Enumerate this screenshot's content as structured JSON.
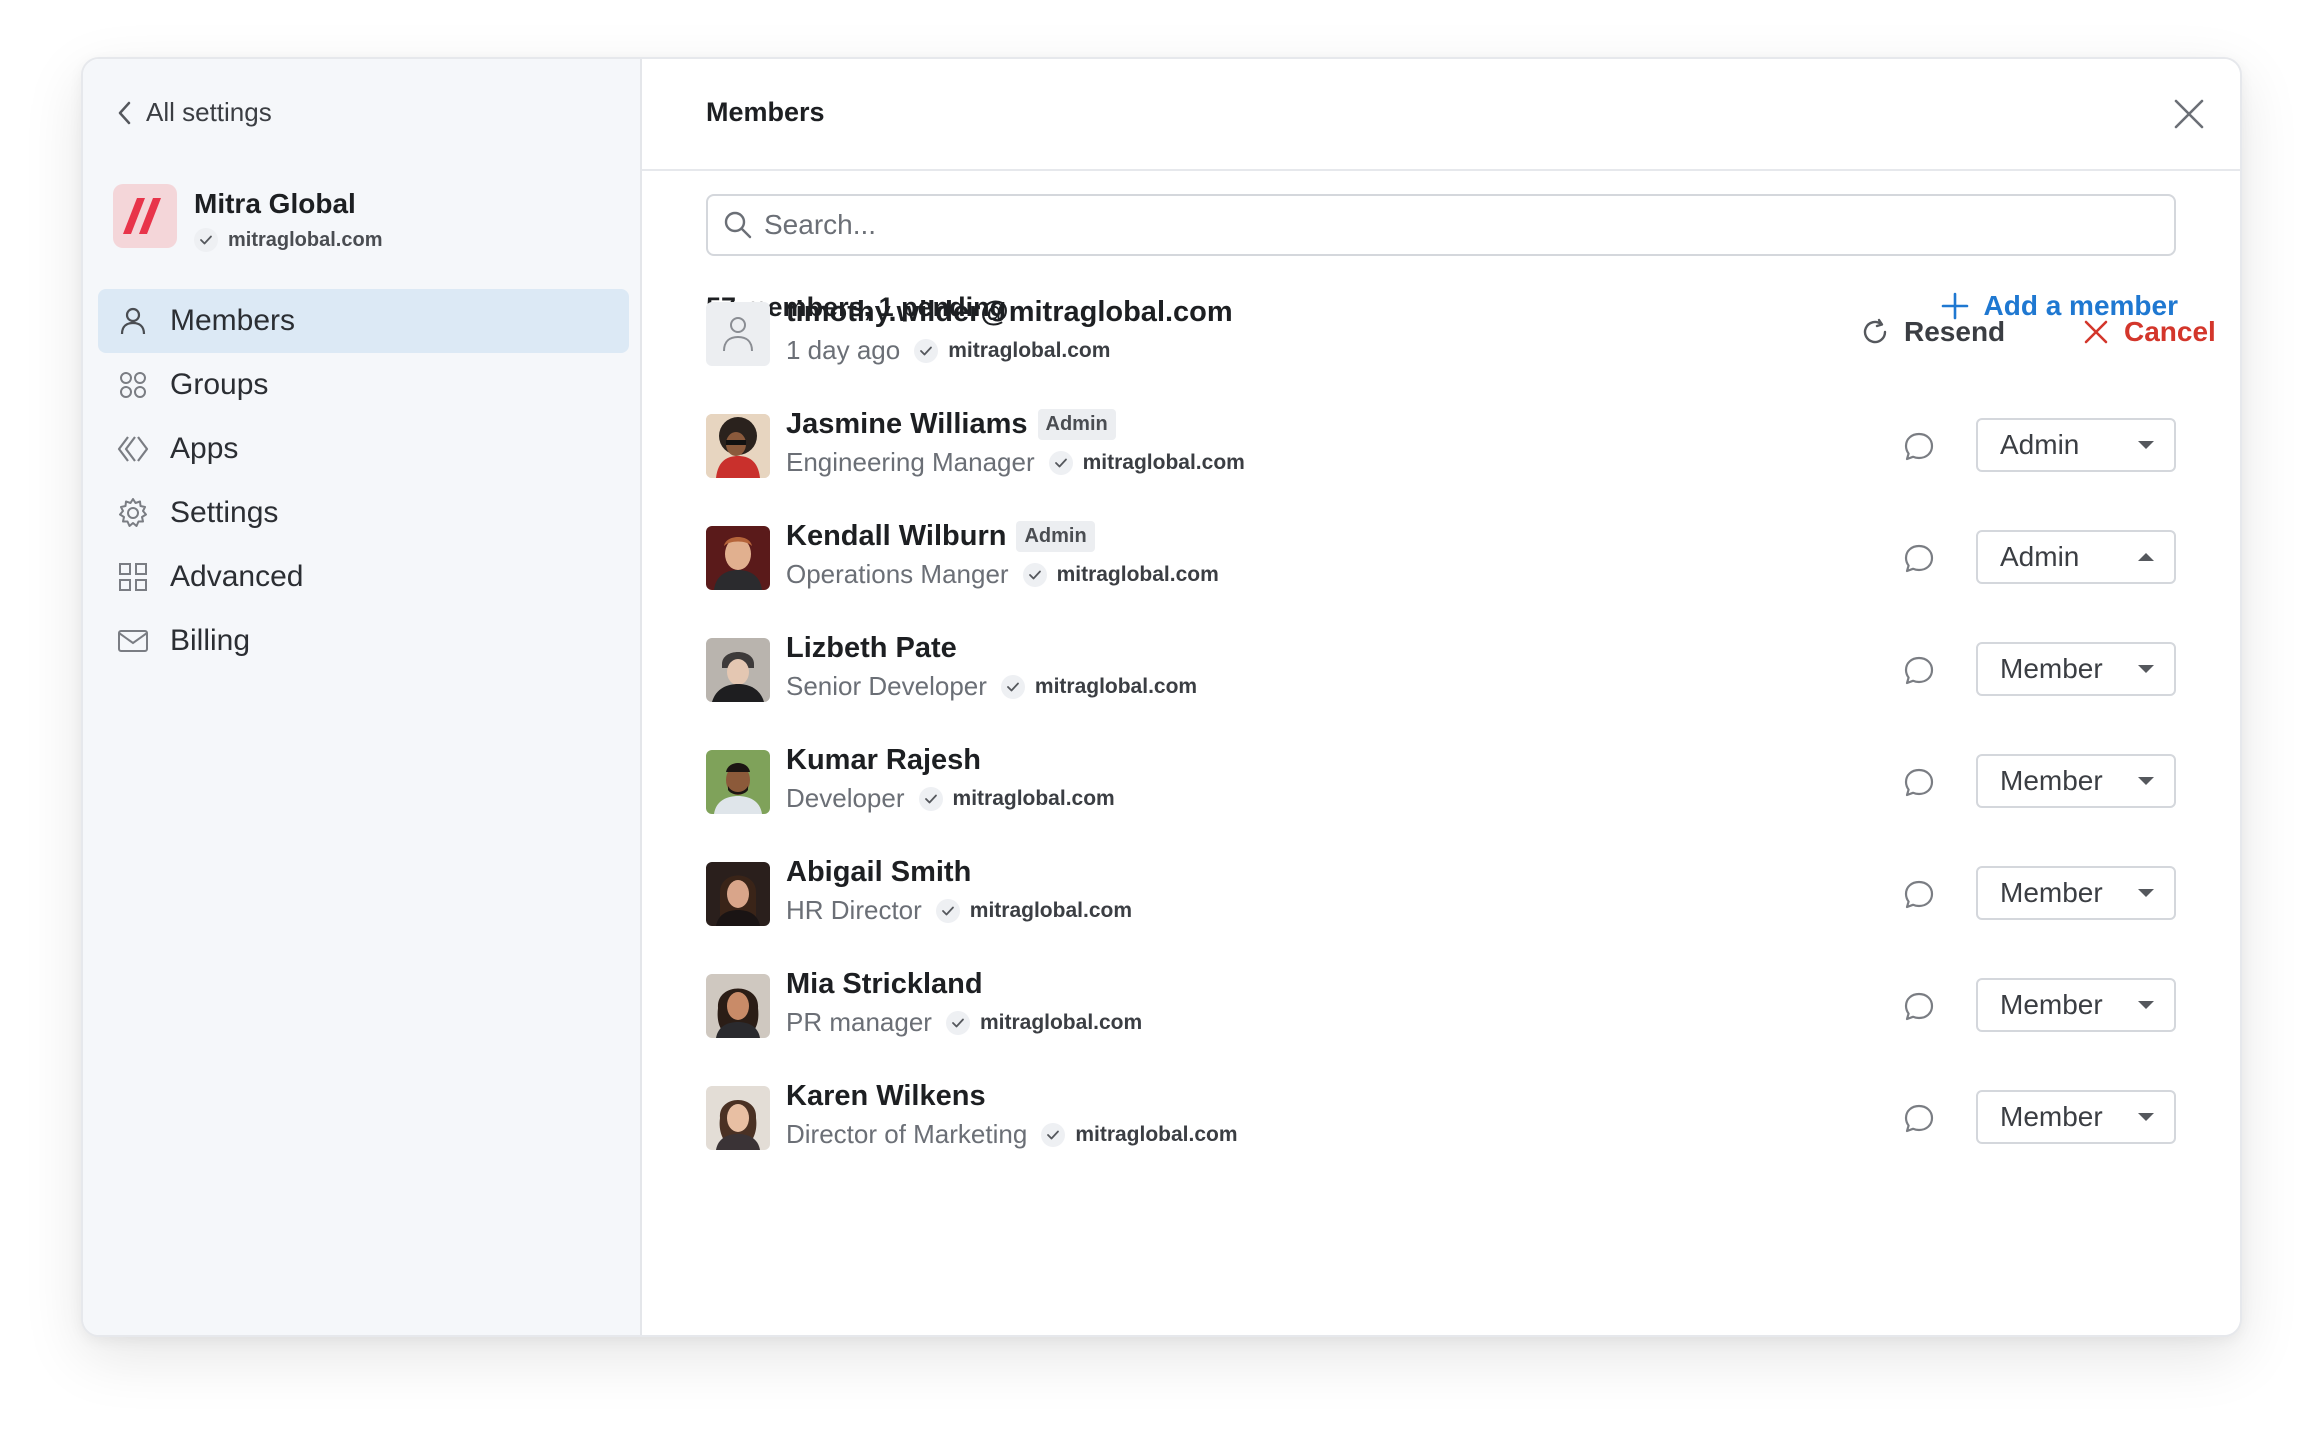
{
  "sidebar": {
    "back_label": "All settings",
    "org": {
      "name": "Mitra Global",
      "domain": "mitraglobal.com",
      "brand_color": "#e8344a"
    },
    "items": [
      {
        "label": "Members",
        "icon": "person-icon",
        "active": true
      },
      {
        "label": "Groups",
        "icon": "groups-icon"
      },
      {
        "label": "Apps",
        "icon": "apps-icon"
      },
      {
        "label": "Settings",
        "icon": "gear-icon"
      },
      {
        "label": "Advanced",
        "icon": "grid-icon"
      },
      {
        "label": "Billing",
        "icon": "mail-icon"
      }
    ]
  },
  "main": {
    "title": "Members",
    "search_placeholder": "Search...",
    "count_text": "57 members, 1 pending",
    "add_label": "Add a member",
    "pending": {
      "email": "timothy.wilder@mitraglobal.com",
      "time": "1 day ago",
      "domain": "mitraglobal.com",
      "resend_label": "Resend",
      "cancel_label": "Cancel"
    },
    "members": [
      {
        "name": "Jasmine Williams",
        "badge": "Admin",
        "title": "Engineering Manager",
        "domain": "mitraglobal.com",
        "role": "Admin",
        "open": false
      },
      {
        "name": "Kendall Wilburn",
        "badge": "Admin",
        "title": "Operations Manger",
        "domain": "mitraglobal.com",
        "role": "Admin",
        "open": true
      },
      {
        "name": "Lizbeth Pate",
        "badge": "",
        "title": "Senior Developer",
        "domain": "mitraglobal.com",
        "role": "Member",
        "open": false
      },
      {
        "name": "Kumar Rajesh",
        "badge": "",
        "title": "Developer",
        "domain": "mitraglobal.com",
        "role": "Member",
        "open": false
      },
      {
        "name": "Abigail Smith",
        "badge": "",
        "title": "HR Director",
        "domain": "mitraglobal.com",
        "role": "Member",
        "open": false
      },
      {
        "name": "Mia Strickland",
        "badge": "",
        "title": "PR manager",
        "domain": "mitraglobal.com",
        "role": "Member",
        "open": false
      },
      {
        "name": "Karen Wilkens",
        "badge": "",
        "title": "Director of Marketing",
        "domain": "mitraglobal.com",
        "role": "Member",
        "open": false
      }
    ]
  },
  "colors": {
    "accent": "#1f78d1",
    "danger": "#d3362b",
    "active_nav": "#dce9f5"
  }
}
